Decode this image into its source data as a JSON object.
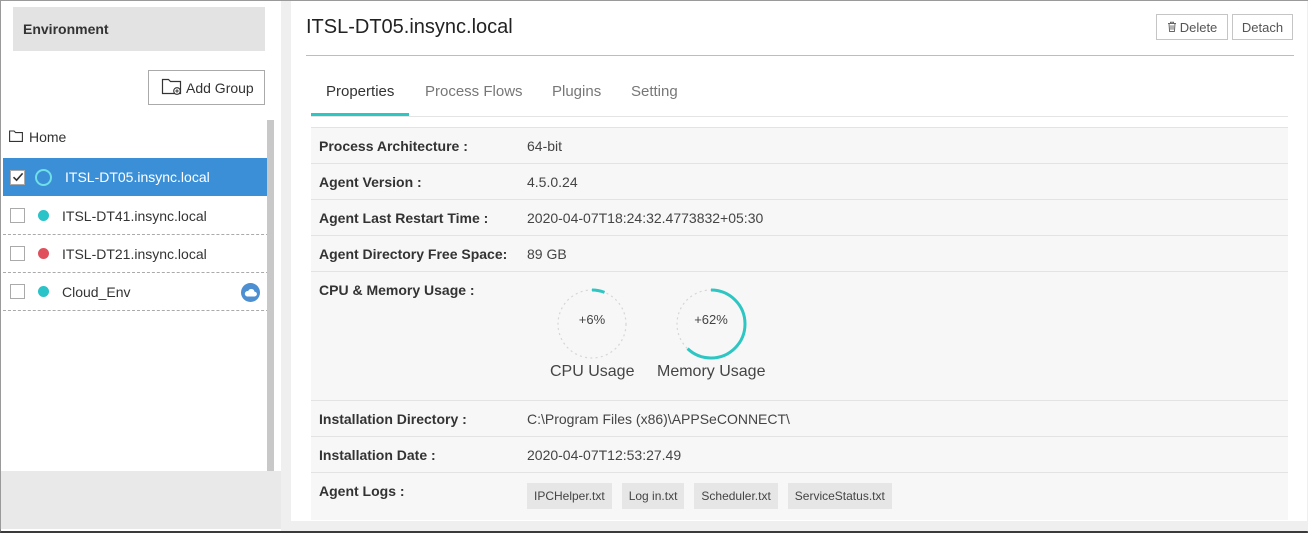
{
  "sidebar": {
    "header": "Environment",
    "add_group_label": "Add Group",
    "home_label": "Home",
    "items": [
      {
        "label": "ITSL-DT05.insync.local",
        "checked": true,
        "status_color": "#6fe0e6",
        "selected": true
      },
      {
        "label": "ITSL-DT41.insync.local",
        "checked": false,
        "status_color": "#29c3c8"
      },
      {
        "label": "ITSL-DT21.insync.local",
        "checked": false,
        "status_color": "#e0505c"
      },
      {
        "label": "Cloud_Env",
        "checked": false,
        "status_color": "#29c3c8",
        "icon": "cloud-icon"
      }
    ]
  },
  "header": {
    "title": "ITSL-DT05.insync.local",
    "delete_label": "Delete",
    "detach_label": "Detach"
  },
  "tabs": [
    {
      "label": "Properties",
      "active": true
    },
    {
      "label": "Process Flows"
    },
    {
      "label": "Plugins"
    },
    {
      "label": "Setting"
    }
  ],
  "properties": {
    "arch_key": "Process Architecture :",
    "arch_val": "64-bit",
    "version_key": "Agent Version :",
    "version_val": "4.5.0.24",
    "restart_key": "Agent Last Restart Time :",
    "restart_val": "2020-04-07T18:24:32.4773832+05:30",
    "freespace_key": "Agent Directory Free Space:",
    "freespace_val": "89 GB",
    "usage_key": "CPU & Memory Usage :",
    "cpu_pct": "+6%",
    "cpu_value": 6,
    "cpu_label": "CPU Usage",
    "mem_pct": "+62%",
    "mem_value": 62,
    "mem_label": "Memory Usage",
    "installdir_key": "Installation Directory :",
    "installdir_val": "C:\\Program Files (x86)\\APPSeCONNECT\\",
    "installdate_key": "Installation Date :",
    "installdate_val": "2020-04-07T12:53:27.49",
    "logs_key": "Agent Logs :",
    "logs": [
      "IPCHelper.txt",
      "Log in.txt",
      "Scheduler.txt",
      "ServiceStatus.txt"
    ]
  },
  "colors": {
    "accent": "#2ec6c2",
    "selection": "#3a8fd6"
  }
}
